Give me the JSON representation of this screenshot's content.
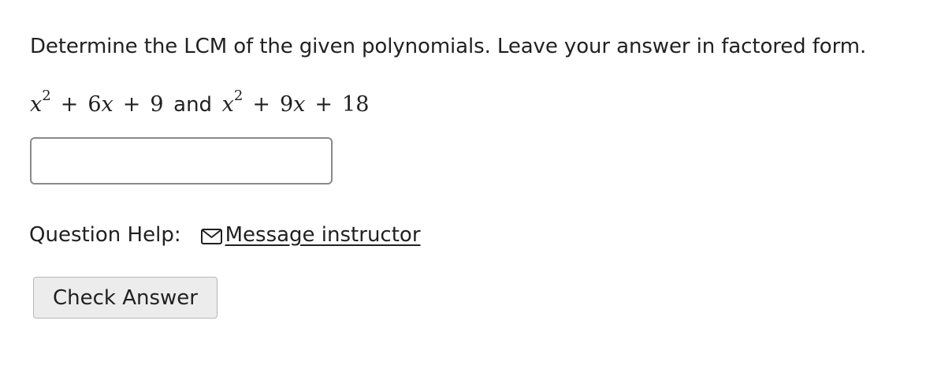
{
  "question": {
    "prompt": "Determine the LCM of the given polynomials. Leave your answer in factored form.",
    "expression": {
      "poly1": {
        "var": "x",
        "exp": "2",
        "plus1": "+",
        "term2": "6",
        "term2_var": "x",
        "plus2": "+",
        "const": "9"
      },
      "connector": "and",
      "poly2": {
        "var": "x",
        "exp": "2",
        "plus1": "+",
        "term2": "9",
        "term2_var": "x",
        "plus2": "+",
        "const": "18"
      }
    }
  },
  "answer_input": {
    "value": "",
    "placeholder": ""
  },
  "help": {
    "label": "Question Help:",
    "message_link": "Message instructor",
    "icon": "envelope-icon"
  },
  "actions": {
    "check_answer": "Check Answer"
  },
  "colors": {
    "text": "#212121",
    "input_border": "#8a8a8a",
    "button_bg": "#ececec",
    "button_border": "#b8b8b8"
  }
}
